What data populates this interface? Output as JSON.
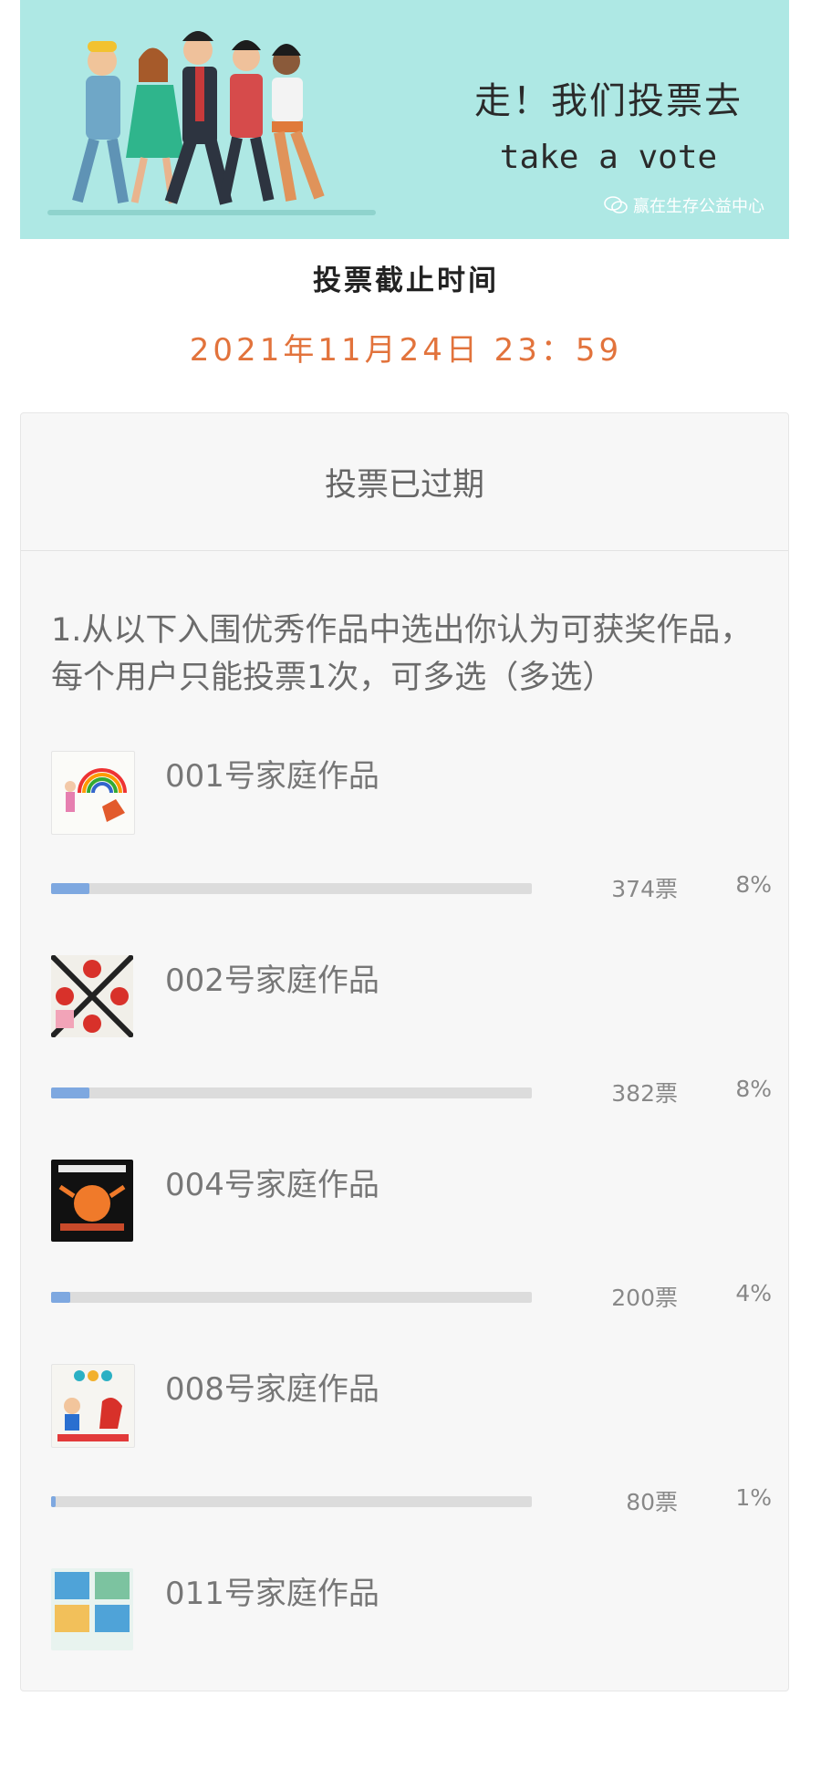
{
  "banner": {
    "title": "走！我们投票去",
    "subtitle": "take a vote",
    "brand": "赢在生存公益中心",
    "bg_color": "#aee8e4"
  },
  "deadline": {
    "label": "投票截止时间",
    "value": "2021年11月24日 23：59",
    "value_color": "#e2733c"
  },
  "vote": {
    "status": "投票已过期",
    "question": "1.从以下入围优秀作品中选出你认为可获奖作品，每个用户只能投票1次，可多选（多选）",
    "bar_color": "#7ea8e0",
    "options": [
      {
        "name": "001号家庭作品",
        "votes": "374票",
        "percent": "8%",
        "fraction": 0.08,
        "thumb": "rainbow-drawing"
      },
      {
        "name": "002号家庭作品",
        "votes": "382票",
        "percent": "8%",
        "fraction": 0.08,
        "thumb": "monster-poster"
      },
      {
        "name": "004号家庭作品",
        "votes": "200票",
        "percent": "4%",
        "fraction": 0.04,
        "thumb": "dark-monster-poster"
      },
      {
        "name": "008号家庭作品",
        "votes": "80票",
        "percent": "1%",
        "fraction": 0.01,
        "thumb": "kids-poster"
      },
      {
        "name": "011号家庭作品",
        "votes": "",
        "percent": "",
        "fraction": null,
        "thumb": "comic-poster"
      }
    ]
  }
}
